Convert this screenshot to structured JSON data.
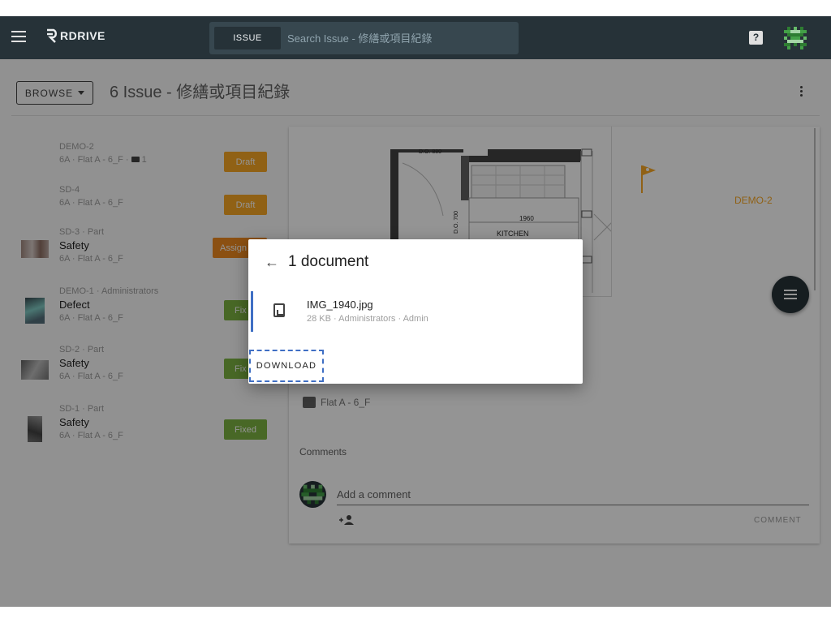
{
  "topbar": {
    "brand": "RDRIVE",
    "search_chip": "ISSUE",
    "search_placeholder": "Search Issue - 修繕或項目紀錄",
    "help_icon": "help-icon",
    "avatar_icon": "user-avatar"
  },
  "header": {
    "browse_label": "BROWSE",
    "title": "6 Issue - 修繕或項目紀錄",
    "more_icon": "more-vertical-icon"
  },
  "issues": [
    {
      "id": "DEMO-2",
      "name": "",
      "location": "6A · Flat A - 6_F · ",
      "folder_count": "1",
      "status": "Draft",
      "status_color": "#f9a825",
      "has_thumb": false
    },
    {
      "id": "SD-4",
      "name": "",
      "location": "6A · Flat A - 6_F",
      "status": "Draft",
      "status_color": "#f9a825",
      "has_thumb": false
    },
    {
      "id": "SD-3 · Part",
      "name": "Safety",
      "location": "6A · Flat A - 6_F",
      "status": "Assign",
      "status_color": "#ef8a1f",
      "has_thumb": true
    },
    {
      "id": "DEMO-1 · Administrators",
      "name": "Defect",
      "location": "6A · Flat A - 6_F",
      "status": "Fix",
      "status_color": "#7cb342",
      "has_thumb": true
    },
    {
      "id": "SD-2 · Part",
      "name": "Safety",
      "location": "6A · Flat A - 6_F",
      "status": "Fix",
      "status_color": "#7cb342",
      "has_thumb": true
    },
    {
      "id": "SD-1 · Part",
      "name": "Safety",
      "location": "6A · Flat A - 6_F",
      "status": "Fixed",
      "status_color": "#7cb342",
      "has_thumb": true
    }
  ],
  "detail": {
    "plan_labels": {
      "door": "D.O. 880",
      "door2": "D.O. 700",
      "width": "1960",
      "room": "KITCHEN",
      "height": "2120"
    },
    "marker_label": "DEMO-2",
    "location": "Flat A - 6_F",
    "comments_label": "Comments",
    "comment_placeholder": "Add a comment",
    "comment_button": "COMMENT"
  },
  "dialog": {
    "title": "1 document",
    "file_name": "IMG_1940.jpg",
    "file_meta": "28 KB · Administrators · Admin",
    "download_label": "DOWNLOAD"
  }
}
